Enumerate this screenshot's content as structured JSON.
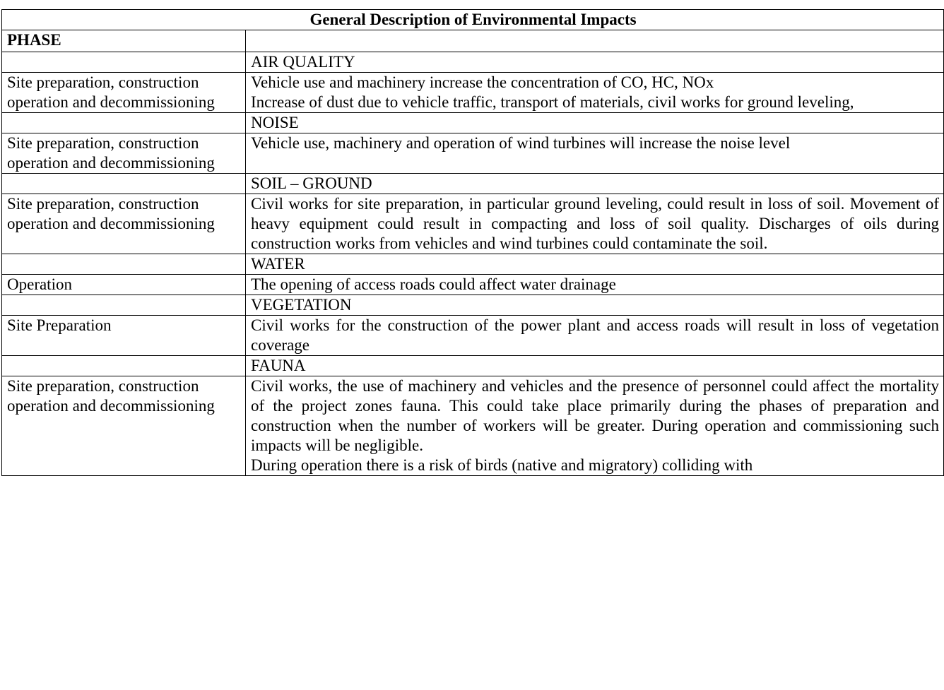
{
  "table": {
    "title": "General Description of Environmental Impacts",
    "phase_header": "PHASE",
    "sections": [
      {
        "category": "AIR QUALITY",
        "phase": "Site preparation, construction operation and decommissioning",
        "description_lines": [
          "Vehicle use and machinery increase the concentration of CO, HC, NOx",
          "Increase of dust due to vehicle traffic, transport of materials, civil works for ground leveling,"
        ]
      },
      {
        "category": "NOISE",
        "phase": "Site preparation, construction operation and decommissioning",
        "description_lines": [
          "Vehicle use, machinery and operation of wind turbines will increase the noise level"
        ]
      },
      {
        "category": "SOIL – GROUND",
        "phase": "Site preparation, construction operation and decommissioning",
        "description_lines": [
          "Civil works for site preparation, in particular ground leveling, could result in loss of soil.  Movement of heavy equipment could result in compacting and loss of soil quality.  Discharges of oils during construction works from vehicles and wind turbines could contaminate the soil."
        ]
      },
      {
        "category": "WATER",
        "phase": "Operation",
        "description_lines": [
          "The opening of access roads could affect water drainage"
        ]
      },
      {
        "category": "VEGETATION",
        "phase": "Site Preparation",
        "description_lines": [
          "Civil works for the construction of the power plant and access roads will result in loss of vegetation coverage"
        ]
      },
      {
        "category": "FAUNA",
        "phase": "Site preparation, construction operation and decommissioning",
        "description_lines": [
          "Civil works, the use of machinery and vehicles and the presence of personnel could affect the mortality of the project zones fauna.  This could take place primarily during the phases of preparation and construction when the number of workers will be greater.  During operation and commissioning such impacts will be negligible.",
          "During operation there is a risk of birds (native and migratory) colliding with"
        ]
      }
    ]
  }
}
